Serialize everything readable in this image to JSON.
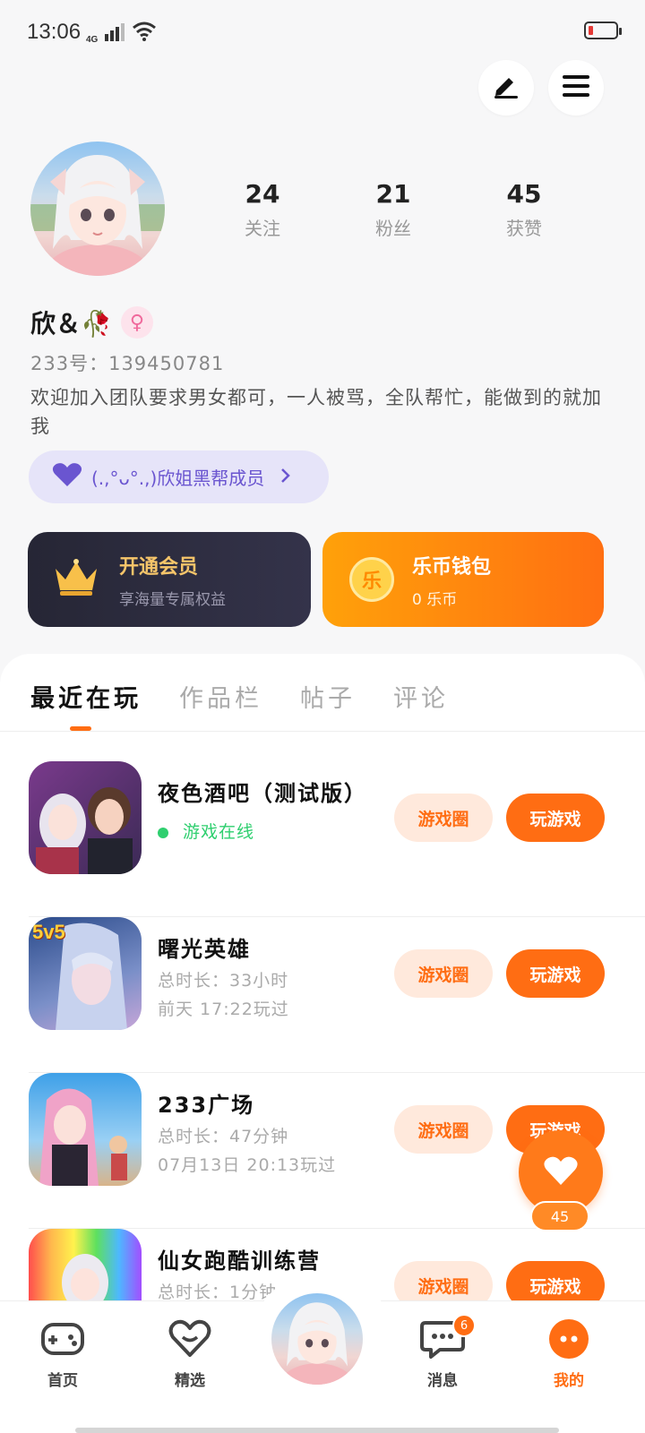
{
  "status_bar": {
    "time": "13:06",
    "network": "4G"
  },
  "profile": {
    "stats": [
      {
        "value": "24",
        "label": "关注"
      },
      {
        "value": "21",
        "label": "粉丝"
      },
      {
        "value": "45",
        "label": "获赞"
      }
    ],
    "nickname": "欣＆🥀",
    "uid": "233号：139450781",
    "bio": "欢迎加入团队要求男女都可，一人被骂，全队帮忙，能做到的就加我",
    "club": "(.,°ᴗ°.,)欣姐黑帮成员"
  },
  "cards": {
    "vip": {
      "title": "开通会员",
      "subtitle": "享海量专属权益"
    },
    "wallet": {
      "title": "乐币钱包",
      "subtitle": "0 乐币",
      "coin_char": "乐"
    }
  },
  "tabs": [
    "最近在玩",
    "作品栏",
    "帖子",
    "评论"
  ],
  "games": [
    {
      "name": "夜色酒吧（测试版）",
      "online": "游戏在线",
      "circle_label": "游戏圈",
      "play_label": "玩游戏"
    },
    {
      "name": "曙光英雄",
      "meta1": "总时长：33小时",
      "meta2": "前天 17:22玩过",
      "circle_label": "游戏圈",
      "play_label": "玩游戏",
      "badge": "5v5"
    },
    {
      "name": "233广场",
      "meta1": "总时长：47分钟",
      "meta2": "07月13日 20:13玩过",
      "circle_label": "游戏圈",
      "play_label": "玩游戏"
    },
    {
      "name": "仙女跑酷训练营",
      "meta1": "总时长：1分钟",
      "circle_label": "游戏圈",
      "play_label": "玩游戏"
    }
  ],
  "like_float": {
    "count": "45"
  },
  "bottom_nav": {
    "home": "首页",
    "featured": "精选",
    "messages": "消息",
    "messages_badge": "6",
    "mine": "我的"
  },
  "colors": {
    "accent": "#ff6d13",
    "online": "#2fcf6f",
    "club": "#6a55d0"
  }
}
